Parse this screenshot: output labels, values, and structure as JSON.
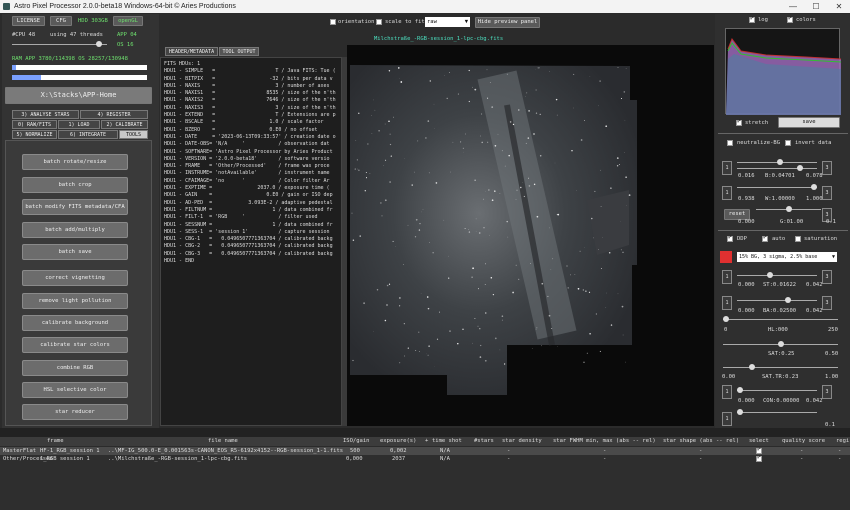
{
  "window": {
    "title": "Astro Pixel Processor 2.0.0-beta18 Windows-64-bit © Aries Productions",
    "min": "—",
    "max": "☐",
    "close": "✕"
  },
  "top": {
    "license": "LICENSE",
    "cfg": "CFG",
    "hdd": "HDD 303GB",
    "opengl": "openGL",
    "cpu": "#CPU 48",
    "threads": "using 47 threads",
    "app": "APP 04",
    "os": "OS 16",
    "ram": "RAM  APP 3780/114398   OS 28257/130948",
    "threads_pct": 0.88,
    "folder": "X:\\Stacks\\APP-Home"
  },
  "tabs": [
    "3) ANALYSE STARS",
    "4) REGISTER",
    "0) RAW/FITS",
    "1) LOAD",
    "2) CALIBRATE",
    "5) NORMALIZE",
    "6) INTEGRATE",
    "TOOLS"
  ],
  "tools": [
    "batch rotate/resize",
    "batch crop",
    "batch modify FITS metadata/CFA",
    "batch add/multiply",
    "batch save",
    "correct vignetting",
    "remove light pollution",
    "calibrate background",
    "calibrate star colors",
    "combine RGB",
    "HSL selective color",
    "star reducer"
  ],
  "view": {
    "orientation": "orientation",
    "scale": "scale to fit",
    "mode": "raw",
    "hide": "Hide preview panel",
    "file": "Milchstraße_-RGB-session_1-lpc-cbg.fits"
  },
  "meta": {
    "tab1": "HEADER/METADATA",
    "tab2": "TOOL OUTPUT",
    "hdus": "FITS HDUs: 1",
    "lines": [
      "HDU1 - SIMPLE   =                    T / Java FITS: Tue (",
      "HDU1 - BITPIX   =                  -32 / bits per data v",
      "HDU1 - NAXIS    =                    3 / number of axes",
      "HDU1 - NAXIS1   =                 8535 / size of the n'th",
      "HDU1 - NAXIS2   =                 7646 / size of the n'th",
      "HDU1 - NAXIS3   =                    3 / size of the n'th",
      "HDU1 - EXTEND   =                    T / Extensions are p",
      "HDU1 - BSCALE   =                  1.0 / scale factor",
      "HDU1 - BZERO    =                  0.E0 / no offset",
      "HDU1 - DATE     = '2023-06-13T09:33:57' / creation date o",
      "HDU1 - DATE-OBS= 'N/A     '           / observation dat",
      "HDU1 - SOFTWARE= 'Astro Pixel Processor by Aries Product",
      "HDU1 - VERSION = '2.0.0-beta18'       / software versio",
      "HDU1 - FRAME   = 'Other/Processed'    / frame was proce",
      "HDU1 - INSTRUME= 'notAvailable'       / instrument name",
      "HDU1 - CFAIMAGE= 'no      '           / Color filter Ar",
      "HDU1 - EXPTIME =               2037.0 / exposure time (",
      "HDU1 - GAIN    =                  0.E0 / gain or ISO dep",
      "HDU1 - AD-PED  =            3.093E-2 / adaptive pedestal",
      "HDU1 - FILTNUM =                    1 / data combined fr",
      "HDU1 - FILT-1  = 'RGB     '           / filter used",
      "HDU1 - SESSNUM =                    1 / data combined fr",
      "HDU1 - SESS-1  = 'session 1'          / capture session",
      "HDU1 - CBG-1   =   0.0496507771363704 / calibrated backg",
      "HDU1 - CBG-2   =   0.0496507771363704 / calibrated backg",
      "HDU1 - CBG-3   =   0.0496507771363704 / calibrated backg",
      "HDU1 - END"
    ]
  },
  "right": {
    "log": "log",
    "colors": "colors",
    "stretch": "stretch",
    "save": "save",
    "neutralize": "neutralize-BG",
    "invert": "invert data",
    "bvals": [
      "0.016",
      "B:0.04701",
      "0.078"
    ],
    "wvals": [
      "0.938",
      "W:1.00000",
      "1.000"
    ],
    "reset": "reset",
    "gvals": [
      "0.000",
      "G:01.00",
      "0.1"
    ],
    "ddp": "DDP",
    "auto": "auto",
    "saturation": "saturation",
    "preset": "15% BG, 3 sigma, 2.5% base",
    "st": [
      "0.000",
      "ST:0.01622",
      "0.042"
    ],
    "ba": [
      "0.000",
      "BA:0.02500",
      "0.042"
    ],
    "hl": [
      "0",
      "HL:000",
      "250"
    ],
    "sat": [
      "",
      "SAT:0.25",
      "0.50"
    ],
    "sattr": [
      "0.00",
      "SAT.TR:0.23",
      "1.00"
    ],
    "con": [
      "0.000",
      "CON:0.00000",
      "0.042"
    ],
    "last": [
      "",
      "",
      "0.1"
    ],
    "sq": "1",
    "sq3": "3"
  },
  "table": {
    "headers": [
      "frame",
      "file name",
      "ISO/gain",
      "exposure(s)",
      "+",
      "time shot",
      "#stars",
      "star density",
      "star FWHM min, max (abs -- rel)",
      "star shape (abs -- rel)",
      "select",
      "quality score",
      "regi"
    ],
    "rows": [
      [
        "MasterFlat",
        "HF-1_RGB_session 1",
        "..\\MF-IG_500.0-E_0.001563s-CANON_EOS_R5-6192x4152--RGB-session_1-1.fits",
        "500",
        "0,002",
        "",
        "N/A",
        "-",
        "-",
        "-",
        "-",
        "-"
      ],
      [
        "Other/Processed",
        "1_RGB session 1",
        "..\\Milchstraße_-RGB-session_1-lpc-cbg.fits",
        "0,000",
        "2037",
        "",
        "N/A",
        "-",
        "-",
        "-",
        "-",
        "-"
      ]
    ]
  }
}
